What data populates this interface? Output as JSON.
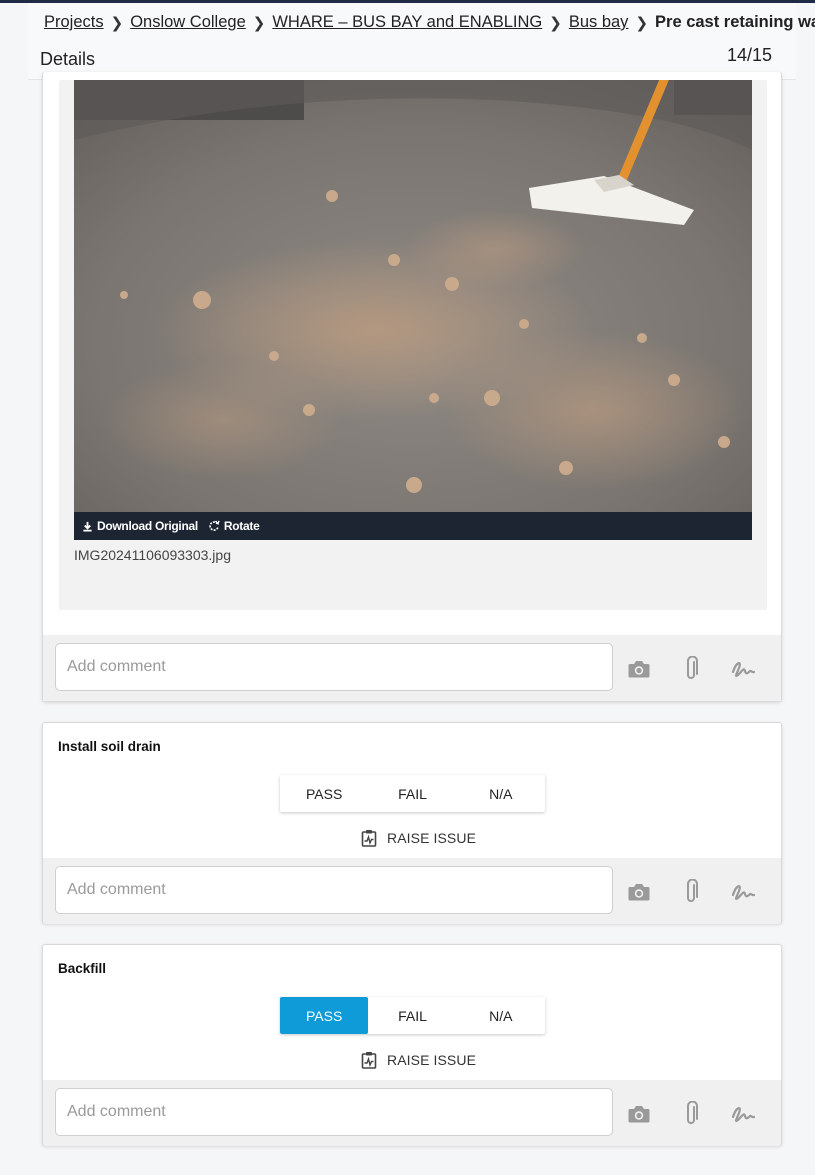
{
  "breadcrumb": [
    {
      "label": "Projects"
    },
    {
      "label": "Onslow College"
    },
    {
      "label": "WHARE – BUS BAY and ENABLING"
    },
    {
      "label": "Bus bay"
    },
    {
      "label": "Pre cast retaining wall"
    }
  ],
  "header": {
    "details_label": "Details",
    "counter": "14/15"
  },
  "photo": {
    "download_label": "Download Original",
    "rotate_label": "Rotate",
    "filename": "IMG20241106093303.jpg"
  },
  "comment": {
    "placeholder": "Add comment"
  },
  "items": [
    {
      "title": "Install soil drain",
      "options": [
        "PASS",
        "FAIL",
        "N/A"
      ],
      "selected": null,
      "raise_issue_label": "RAISE ISSUE"
    },
    {
      "title": "Backfill",
      "options": [
        "PASS",
        "FAIL",
        "N/A"
      ],
      "selected": "PASS",
      "raise_issue_label": "RAISE ISSUE"
    }
  ],
  "colors": {
    "accent": "#0e9bd8",
    "photo_bar": "#1d2533",
    "header_line": "#1f2a44"
  },
  "icons": [
    "chevron-right-icon",
    "download-icon",
    "rotate-icon",
    "camera-icon",
    "paperclip-icon",
    "signature-icon",
    "clipboard-pulse-icon"
  ]
}
